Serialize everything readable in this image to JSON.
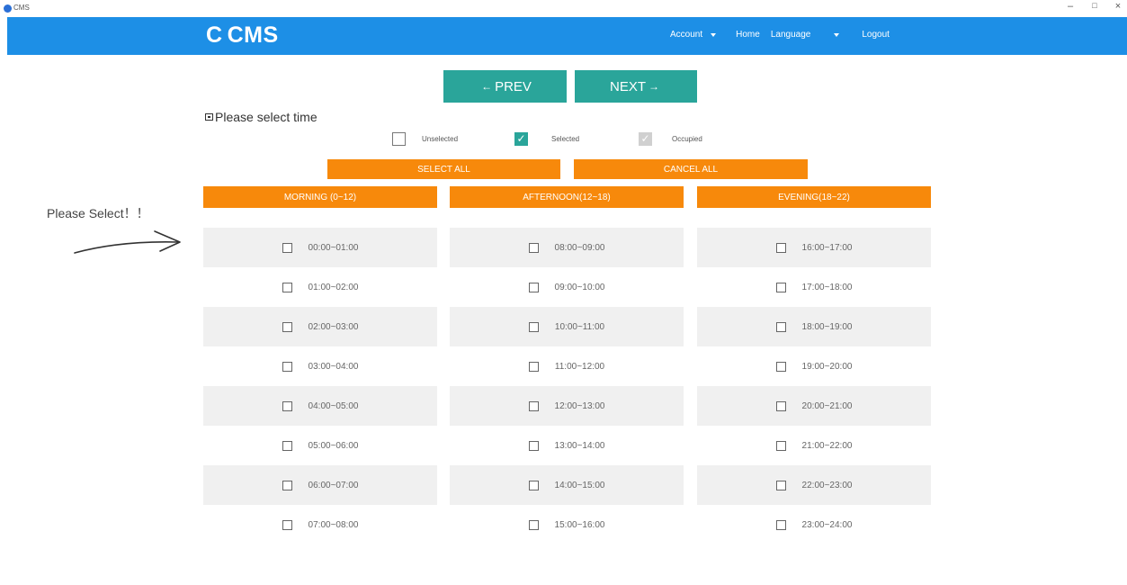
{
  "window": {
    "title": "CMS",
    "minimize": "–",
    "maximize": "□",
    "close": "×"
  },
  "header": {
    "logo_letter": "C",
    "logo_text": "CMS",
    "nav": {
      "account": "Account",
      "home": "Home",
      "language": "Language",
      "logout": "Logout"
    }
  },
  "pager": {
    "prev": "PREV",
    "next": "NEXT",
    "prev_arrow": "←",
    "next_arrow": "→"
  },
  "page_title": "Please select time",
  "legend": {
    "unselected": "Unselected",
    "selected": "Selected",
    "occupied": "Occupied",
    "check": "✓"
  },
  "actions": {
    "select_all": "SELECT ALL",
    "cancel_all": "CANCEL ALL"
  },
  "hint": "Please Select！！",
  "columns": [
    {
      "header": "MORNING (0~12)",
      "slots": [
        "00:00~01:00",
        "01:00~02:00",
        "02:00~03:00",
        "03:00~04:00",
        "04:00~05:00",
        "05:00~06:00",
        "06:00~07:00",
        "07:00~08:00"
      ]
    },
    {
      "header": "AFTERNOON(12~18)",
      "slots": [
        "08:00~09:00",
        "09:00~10:00",
        "10:00~11:00",
        "11:00~12:00",
        "12:00~13:00",
        "13:00~14:00",
        "14:00~15:00",
        "15:00~16:00"
      ]
    },
    {
      "header": "EVENING(18~22)",
      "slots": [
        "16:00~17:00",
        "17:00~18:00",
        "18:00~19:00",
        "19:00~20:00",
        "20:00~21:00",
        "21:00~22:00",
        "22:00~23:00",
        "23:00~24:00"
      ]
    }
  ],
  "colors": {
    "nav_blue": "#1d8fe6",
    "teal": "#2aa59a",
    "orange": "#f7890b",
    "row_shade": "#f0f0f0"
  }
}
